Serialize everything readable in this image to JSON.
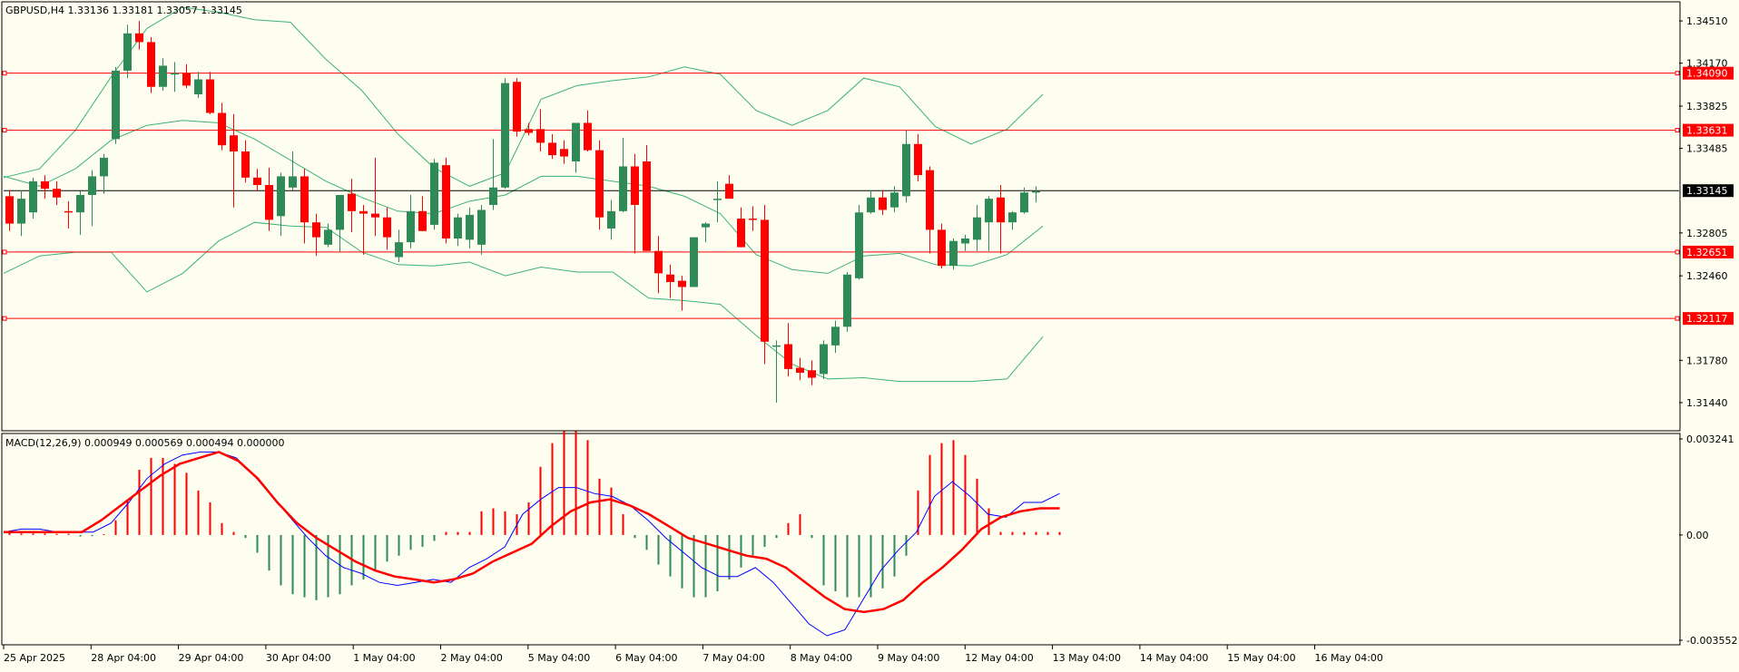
{
  "header": {
    "main_title": "GBPUSD,H4  1.33136 1.33181 1.33057 1.33145",
    "macd_title": "MACD(12,26,9) 0.000949 0.000569 0.000494 0.000000"
  },
  "colors": {
    "background": "#fefef0",
    "bull": "#2e8b57",
    "bear": "#ff0000",
    "bands": "#3cb371",
    "level_line": "#ff0000",
    "current_line": "#000000",
    "macd_line": "#0000ff",
    "signal_line": "#ff0000"
  },
  "chart_data": [
    {
      "type": "candlestick",
      "title": "GBPUSD,H4  1.33136 1.33181 1.33057 1.33145",
      "price_scale": {
        "min": 1.3125,
        "max": 1.3462
      },
      "y_tick_labels": [
        "1.34510",
        "1.34170",
        "1.33825",
        "1.33485",
        "1.32805",
        "1.32460",
        "1.31780",
        "1.31440"
      ],
      "x_tick_labels": [
        "25 Apr 2025",
        "28 Apr 04:00",
        "29 Apr 04:00",
        "30 Apr 04:00",
        "1 May 04:00",
        "2 May 04:00",
        "5 May 04:00",
        "6 May 04:00",
        "7 May 04:00",
        "8 May 04:00",
        "9 May 04:00",
        "12 May 04:00",
        "13 May 04:00",
        "14 May 04:00",
        "15 May 04:00",
        "16 May 04:00"
      ],
      "current_price": {
        "value": 1.33145,
        "label": "1.33145"
      },
      "levels": [
        {
          "value": 1.3409,
          "label": "1.34090"
        },
        {
          "value": 1.33631,
          "label": "1.33631"
        },
        {
          "value": 1.32651,
          "label": "1.32651"
        },
        {
          "value": 1.32117,
          "label": "1.32117"
        }
      ],
      "candles": [
        [
          1.331,
          1.3315,
          1.3282,
          1.3288
        ],
        [
          1.3288,
          1.3315,
          1.3278,
          1.3308
        ],
        [
          1.3297,
          1.3325,
          1.3292,
          1.3322
        ],
        [
          1.3322,
          1.3327,
          1.3308,
          1.3316
        ],
        [
          1.3316,
          1.3322,
          1.3303,
          1.3309
        ],
        [
          1.3298,
          1.3306,
          1.3284,
          1.3297
        ],
        [
          1.3297,
          1.3314,
          1.3279,
          1.3311
        ],
        [
          1.3311,
          1.3331,
          1.3286,
          1.3326
        ],
        [
          1.3326,
          1.3344,
          1.3312,
          1.3341
        ],
        [
          1.3356,
          1.3414,
          1.3352,
          1.3411
        ],
        [
          1.3411,
          1.3448,
          1.3405,
          1.3441
        ],
        [
          1.3441,
          1.3451,
          1.3428,
          1.3434
        ],
        [
          1.3434,
          1.3438,
          1.3393,
          1.3398
        ],
        [
          1.3398,
          1.3421,
          1.3395,
          1.3415
        ],
        [
          1.3408,
          1.3418,
          1.3394,
          1.3409
        ],
        [
          1.3409,
          1.3416,
          1.3397,
          1.3399
        ],
        [
          1.3392,
          1.341,
          1.3389,
          1.3404
        ],
        [
          1.3404,
          1.341,
          1.3376,
          1.3377
        ],
        [
          1.3377,
          1.3385,
          1.3347,
          1.3351
        ],
        [
          1.3359,
          1.3376,
          1.3301,
          1.3346
        ],
        [
          1.3346,
          1.3355,
          1.3321,
          1.3325
        ],
        [
          1.3325,
          1.3332,
          1.3314,
          1.3319
        ],
        [
          1.3319,
          1.3333,
          1.3282,
          1.3291
        ],
        [
          1.3294,
          1.3329,
          1.3278,
          1.3326
        ],
        [
          1.3317,
          1.3346,
          1.3315,
          1.3326
        ],
        [
          1.3326,
          1.3332,
          1.3272,
          1.3289
        ],
        [
          1.3289,
          1.3296,
          1.3262,
          1.3277
        ],
        [
          1.3271,
          1.3288,
          1.3269,
          1.3283
        ],
        [
          1.3283,
          1.3302,
          1.3265,
          1.3311
        ],
        [
          1.3312,
          1.3324,
          1.3281,
          1.3298
        ],
        [
          1.3298,
          1.3303,
          1.3263,
          1.3296
        ],
        [
          1.3296,
          1.3341,
          1.3278,
          1.3293
        ],
        [
          1.3293,
          1.3301,
          1.3267,
          1.3277
        ],
        [
          1.3261,
          1.3283,
          1.3257,
          1.3273
        ],
        [
          1.3273,
          1.3311,
          1.3268,
          1.3298
        ],
        [
          1.3298,
          1.331,
          1.3282,
          1.3282
        ],
        [
          1.3287,
          1.334,
          1.3283,
          1.3337
        ],
        [
          1.3335,
          1.3341,
          1.3272,
          1.3276
        ],
        [
          1.3276,
          1.3296,
          1.327,
          1.3293
        ],
        [
          1.3275,
          1.3301,
          1.3268,
          1.3295
        ],
        [
          1.3271,
          1.3303,
          1.3263,
          1.3299
        ],
        [
          1.3303,
          1.3356,
          1.3299,
          1.3317
        ],
        [
          1.3317,
          1.3405,
          1.3316,
          1.3401
        ],
        [
          1.3402,
          1.3405,
          1.3358,
          1.3362
        ],
        [
          1.3364,
          1.3369,
          1.3359,
          1.3361
        ],
        [
          1.3364,
          1.338,
          1.3346,
          1.3353
        ],
        [
          1.3353,
          1.336,
          1.334,
          1.3343
        ],
        [
          1.3348,
          1.3355,
          1.3336,
          1.3342
        ],
        [
          1.3338,
          1.3363,
          1.3329,
          1.3369
        ],
        [
          1.3369,
          1.3379,
          1.3346,
          1.3347
        ],
        [
          1.3347,
          1.3355,
          1.3283,
          1.3293
        ],
        [
          1.3284,
          1.3307,
          1.3275,
          1.3298
        ],
        [
          1.3298,
          1.3357,
          1.3297,
          1.3334
        ],
        [
          1.3334,
          1.3344,
          1.3264,
          1.3303
        ],
        [
          1.3338,
          1.3351,
          1.3266,
          1.3266
        ],
        [
          1.3266,
          1.3278,
          1.3232,
          1.3248
        ],
        [
          1.3247,
          1.3255,
          1.3228,
          1.3241
        ],
        [
          1.3242,
          1.3246,
          1.3218,
          1.3237
        ],
        [
          1.3237,
          1.3277,
          1.3237,
          1.3277
        ],
        [
          1.3285,
          1.3289,
          1.3273,
          1.3288
        ],
        [
          1.3308,
          1.3322,
          1.3289,
          1.3308
        ],
        [
          1.332,
          1.3327,
          1.331,
          1.3308
        ],
        [
          1.3292,
          1.3301,
          1.3269,
          1.3269
        ],
        [
          1.3292,
          1.3302,
          1.3282,
          1.3291
        ],
        [
          1.3291,
          1.3303,
          1.3175,
          1.3193
        ],
        [
          1.3189,
          1.3194,
          1.3144,
          1.319
        ],
        [
          1.3191,
          1.3208,
          1.3165,
          1.3171
        ],
        [
          1.3172,
          1.318,
          1.3162,
          1.3168
        ],
        [
          1.317,
          1.3178,
          1.3158,
          1.3164
        ],
        [
          1.3167,
          1.3194,
          1.3163,
          1.3191
        ],
        [
          1.319,
          1.321,
          1.3184,
          1.3205
        ],
        [
          1.3205,
          1.3249,
          1.3201,
          1.3247
        ],
        [
          1.3244,
          1.3303,
          1.3243,
          1.3297
        ],
        [
          1.3297,
          1.3315,
          1.3296,
          1.3309
        ],
        [
          1.3309,
          1.3315,
          1.3295,
          1.3299
        ],
        [
          1.3301,
          1.3318,
          1.3297,
          1.3313
        ],
        [
          1.331,
          1.3363,
          1.3305,
          1.3352
        ],
        [
          1.3352,
          1.336,
          1.3322,
          1.3327
        ],
        [
          1.3331,
          1.3334,
          1.3264,
          1.3283
        ],
        [
          1.3283,
          1.3288,
          1.3252,
          1.3254
        ],
        [
          1.3254,
          1.3276,
          1.3251,
          1.3274
        ],
        [
          1.3272,
          1.3279,
          1.3266,
          1.3276
        ],
        [
          1.3275,
          1.3303,
          1.3266,
          1.3293
        ],
        [
          1.3289,
          1.331,
          1.3266,
          1.3308
        ],
        [
          1.3309,
          1.3319,
          1.3264,
          1.3289
        ],
        [
          1.3289,
          1.3298,
          1.3283,
          1.3297
        ],
        [
          1.3297,
          1.3317,
          1.3296,
          1.3313
        ],
        [
          1.3313,
          1.3318,
          1.3305,
          1.3314
        ]
      ],
      "bollinger_upper": [
        1.3325,
        1.3332,
        1.3363,
        1.3406,
        1.3445,
        1.3462,
        1.3458,
        1.3452,
        1.345,
        1.342,
        1.3395,
        1.336,
        1.3333,
        1.3318,
        1.3329,
        1.3388,
        1.3399,
        1.3403,
        1.3406,
        1.3414,
        1.3408,
        1.3379,
        1.3367,
        1.3379,
        1.3405,
        1.3398,
        1.3366,
        1.3352,
        1.3364,
        1.3392
      ],
      "bollinger_middle": [
        1.3326,
        1.3318,
        1.3332,
        1.3355,
        1.3367,
        1.3371,
        1.3369,
        1.3356,
        1.3339,
        1.3322,
        1.3309,
        1.3298,
        1.3296,
        1.3306,
        1.3311,
        1.3326,
        1.3326,
        1.3322,
        1.3318,
        1.331,
        1.3296,
        1.3263,
        1.3251,
        1.3248,
        1.3262,
        1.3264,
        1.3255,
        1.3254,
        1.3263,
        1.3286
      ],
      "bollinger_lower": [
        1.3248,
        1.3262,
        1.3265,
        1.3265,
        1.3233,
        1.3248,
        1.3274,
        1.3289,
        1.3286,
        1.3285,
        1.3265,
        1.3255,
        1.3254,
        1.3257,
        1.3246,
        1.3253,
        1.3249,
        1.3249,
        1.3228,
        1.3226,
        1.3223,
        1.3198,
        1.3175,
        1.3163,
        1.3164,
        1.3161,
        1.3161,
        1.3161,
        1.3163,
        1.3197
      ]
    },
    {
      "type": "macd",
      "title": "MACD(12,26,9) 0.000949 0.000569 0.000494 0.000000",
      "y_range": [
        -0.003552,
        0.003241
      ],
      "y_tick_labels": [
        "0.003241",
        "0.00",
        "-0.003552"
      ],
      "histogram": [
        0.0001,
        5e-05,
        5e-05,
        5e-05,
        4e-05,
        4e-05,
        -5e-05,
        -4e-05,
        3e-05,
        0.0005,
        0.0012,
        0.0022,
        0.0026,
        0.0026,
        0.0024,
        0.0021,
        0.0015,
        0.0011,
        0.0004,
        0.0001,
        -0.0001,
        -0.0006,
        -0.0012,
        -0.0017,
        -0.002,
        -0.0021,
        -0.0022,
        -0.0021,
        -0.002,
        -0.0017,
        -0.0015,
        -0.0012,
        -0.0009,
        -0.0007,
        -0.0005,
        -0.0004,
        -0.0002,
        0.0001,
        0.0001,
        0.0001,
        0.0008,
        0.0009,
        0.0008,
        0.0007,
        0.0011,
        0.0023,
        0.0031,
        0.0035,
        0.0035,
        0.0032,
        0.0019,
        0.0016,
        0.0007,
        -0.0001,
        -0.0005,
        -0.001,
        -0.0014,
        -0.0018,
        -0.0021,
        -0.0021,
        -0.0019,
        -0.0015,
        -0.0011,
        -0.0007,
        -0.0004,
        -0.0001,
        0.0004,
        0.0007,
        -0.0001,
        -0.0017,
        -0.0019,
        -0.0021,
        -0.0021,
        -0.0021,
        -0.0018,
        -0.0014,
        -0.0007,
        0.0015,
        0.0027,
        0.0031,
        0.0032,
        0.0027,
        0.0019,
        0.0009,
        0.0001,
        0.0001,
        0.0001,
        0.0001,
        0.0001,
        0.0001
      ],
      "macd_line": [
        0.0001,
        0.0002,
        0.0002,
        0.0001,
        0.0001,
        0.0001,
        0.0004,
        0.0011,
        0.0019,
        0.0024,
        0.0027,
        0.0028,
        0.0028,
        0.0026,
        0.002,
        0.0013,
        0.0006,
        -0.0001,
        -0.0007,
        -0.0011,
        -0.0013,
        -0.0016,
        -0.0017,
        -0.0016,
        -0.0015,
        -0.0016,
        -0.0011,
        -0.0008,
        -0.0004,
        0.0007,
        0.0012,
        0.0016,
        0.0016,
        0.0014,
        0.0013,
        0.001,
        0.0005,
        -0.0001,
        -0.0006,
        -0.0011,
        -0.0014,
        -0.0014,
        -0.0011,
        -0.0016,
        -0.0023,
        -0.003,
        -0.0034,
        -0.0032,
        -0.0022,
        -0.0012,
        -0.0005,
        0.0001,
        0.0013,
        0.0018,
        0.0013,
        0.0007,
        0.0006,
        0.0011,
        0.0011,
        0.0014
      ],
      "signal_line": [
        0.0001,
        0.0001,
        0.0001,
        0.0001,
        0.0001,
        0.0005,
        0.001,
        0.0015,
        0.002,
        0.0024,
        0.0026,
        0.0028,
        0.0025,
        0.0019,
        0.0011,
        0.0004,
        -0.0001,
        -0.0005,
        -0.0009,
        -0.0012,
        -0.0014,
        -0.0015,
        -0.0016,
        -0.0015,
        -0.0013,
        -0.0009,
        -0.0006,
        -0.0003,
        0.0003,
        0.0008,
        0.0011,
        0.0012,
        0.001,
        0.0007,
        0.0003,
        -0.0001,
        -0.0003,
        -0.0005,
        -0.0007,
        -0.0008,
        -0.0011,
        -0.0016,
        -0.0021,
        -0.0025,
        -0.0026,
        -0.0025,
        -0.0022,
        -0.0016,
        -0.0011,
        -0.0005,
        0.0002,
        0.0006,
        0.0008,
        0.0009,
        0.0009
      ]
    }
  ]
}
